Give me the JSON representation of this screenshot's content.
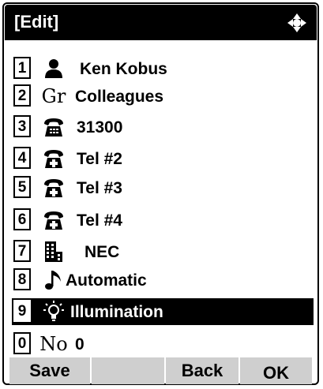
{
  "header": {
    "title": "[Edit]",
    "nav_icon": "four-way-arrow-icon"
  },
  "items": [
    {
      "num": "1",
      "icon": "person-icon",
      "label": "Ken Kobus"
    },
    {
      "num": "2",
      "icon": "group-icon",
      "icon_text": "Gr",
      "label": "Colleagues"
    },
    {
      "num": "3",
      "icon": "extension-phone-icon",
      "label": "31300"
    },
    {
      "num": "4",
      "icon": "telephone-plus-icon",
      "label": "Tel #2"
    },
    {
      "num": "5",
      "icon": "telephone-plus-icon",
      "label": "Tel #3"
    },
    {
      "num": "6",
      "icon": "telephone-plus-icon",
      "label": "Tel #4"
    },
    {
      "num": "7",
      "icon": "building-icon",
      "label": "NEC"
    },
    {
      "num": "8",
      "icon": "music-note-icon",
      "label": "Automatic"
    },
    {
      "num": "9",
      "icon": "light-bulb-icon",
      "label": "Illumination",
      "selected": true
    },
    {
      "num": "0",
      "icon": "number-icon",
      "icon_text": "No",
      "label": "0"
    }
  ],
  "softkeys": {
    "save": "Save",
    "blank": "",
    "back": "Back",
    "ok": "OK"
  },
  "colors": {
    "header_bg": "#000000",
    "softkey_bg": "#cfcfcf",
    "selected_bg": "#000000"
  }
}
